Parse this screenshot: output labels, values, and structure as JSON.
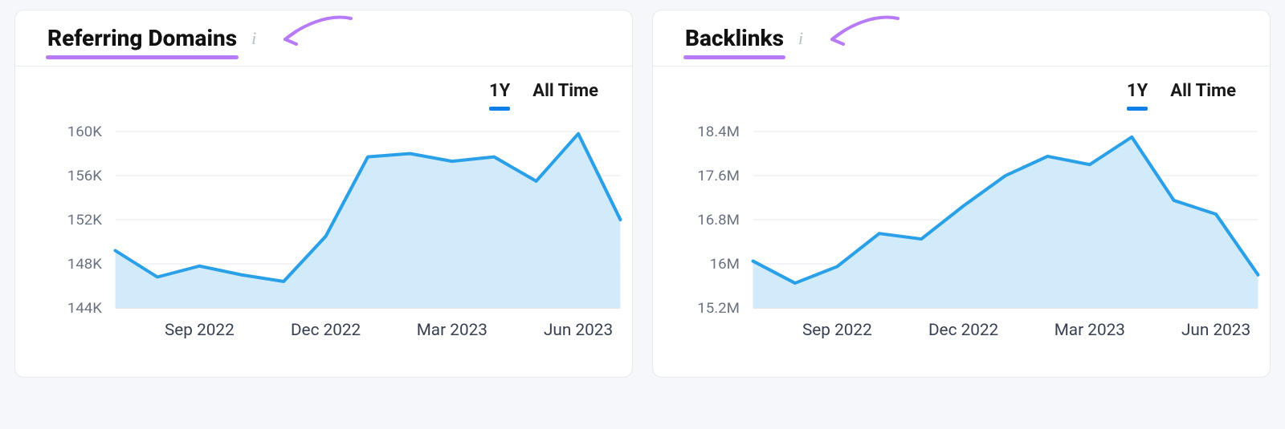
{
  "cards": [
    {
      "title": "Referring Domains",
      "range_tabs": {
        "one_year": "1Y",
        "all_time": "All Time",
        "active": "one_year"
      },
      "chart_data": {
        "type": "area",
        "title": "Referring Domains",
        "xlabel": "",
        "ylabel": "",
        "ylim": [
          144000,
          160000
        ],
        "y_ticks": [
          160000,
          156000,
          152000,
          148000,
          144000
        ],
        "y_tick_labels": [
          "160K",
          "156K",
          "152K",
          "148K",
          "144K"
        ],
        "x_tick_labels": [
          "Sep 2022",
          "Dec 2022",
          "Mar 2023",
          "Jun 2023"
        ],
        "x_months": [
          "Jul 2022",
          "Aug 2022",
          "Sep 2022",
          "Oct 2022",
          "Nov 2022",
          "Dec 2022",
          "Jan 2023",
          "Feb 2023",
          "Mar 2023",
          "Apr 2023",
          "May 2023",
          "Jun 2023",
          "Jul 2023"
        ],
        "values": [
          149200,
          146800,
          147800,
          147000,
          146400,
          150500,
          157700,
          158000,
          157300,
          157700,
          155500,
          159800,
          152000
        ]
      }
    },
    {
      "title": "Backlinks",
      "range_tabs": {
        "one_year": "1Y",
        "all_time": "All Time",
        "active": "one_year"
      },
      "chart_data": {
        "type": "area",
        "title": "Backlinks",
        "xlabel": "",
        "ylabel": "",
        "ylim": [
          15200000,
          18400000
        ],
        "y_ticks": [
          18400000,
          17600000,
          16800000,
          16000000,
          15200000
        ],
        "y_tick_labels": [
          "18.4M",
          "17.6M",
          "16.8M",
          "16M",
          "15.2M"
        ],
        "x_tick_labels": [
          "Sep 2022",
          "Dec 2022",
          "Mar 2023",
          "Jun 2023"
        ],
        "x_months": [
          "Jul 2022",
          "Aug 2022",
          "Sep 2022",
          "Oct 2022",
          "Nov 2022",
          "Dec 2022",
          "Jan 2023",
          "Feb 2023",
          "Mar 2023",
          "Apr 2023",
          "May 2023",
          "Jun 2023",
          "Jul 2023"
        ],
        "values": [
          16050000,
          15650000,
          15950000,
          16550000,
          16450000,
          17050000,
          17600000,
          17950000,
          17800000,
          18300000,
          17150000,
          16900000,
          15800000
        ]
      }
    }
  ]
}
